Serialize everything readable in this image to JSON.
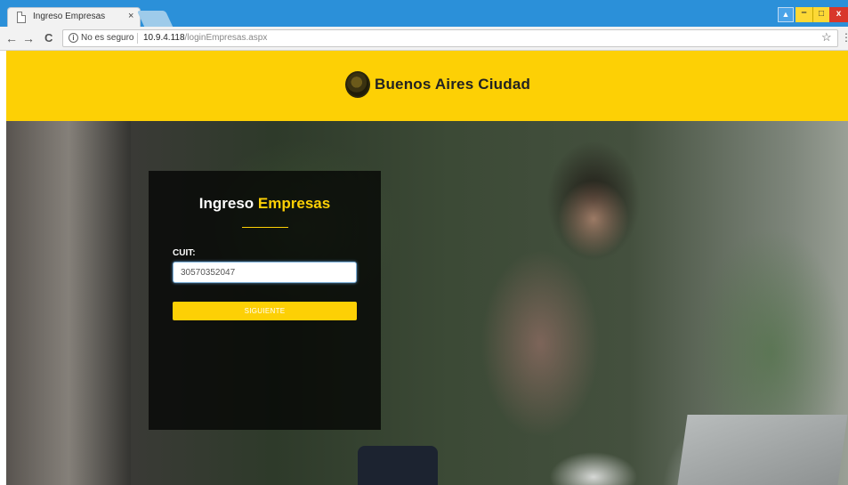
{
  "browser": {
    "tab_title": "Ingreso Empresas",
    "tab_close": "×",
    "security_label": "No es seguro",
    "url_host": "10.9.4.118",
    "url_path": "/loginEmpresas.aspx",
    "icons": {
      "back": "←",
      "forward": "→",
      "reload": "C",
      "info": "i",
      "star": "☆",
      "menu": "⋮",
      "user": "👤",
      "minimize": "–",
      "maximize": "▢",
      "close": "x"
    }
  },
  "header": {
    "brand": "Buenos Aires Ciudad",
    "brand_color": "#fdd005"
  },
  "login": {
    "title_part1": "Ingreso",
    "title_part2": "Empresas",
    "cuit_label": "CUIT:",
    "cuit_value": "30570352047",
    "submit_label": "SIGUIENTE",
    "accent_color": "#fdd005"
  }
}
